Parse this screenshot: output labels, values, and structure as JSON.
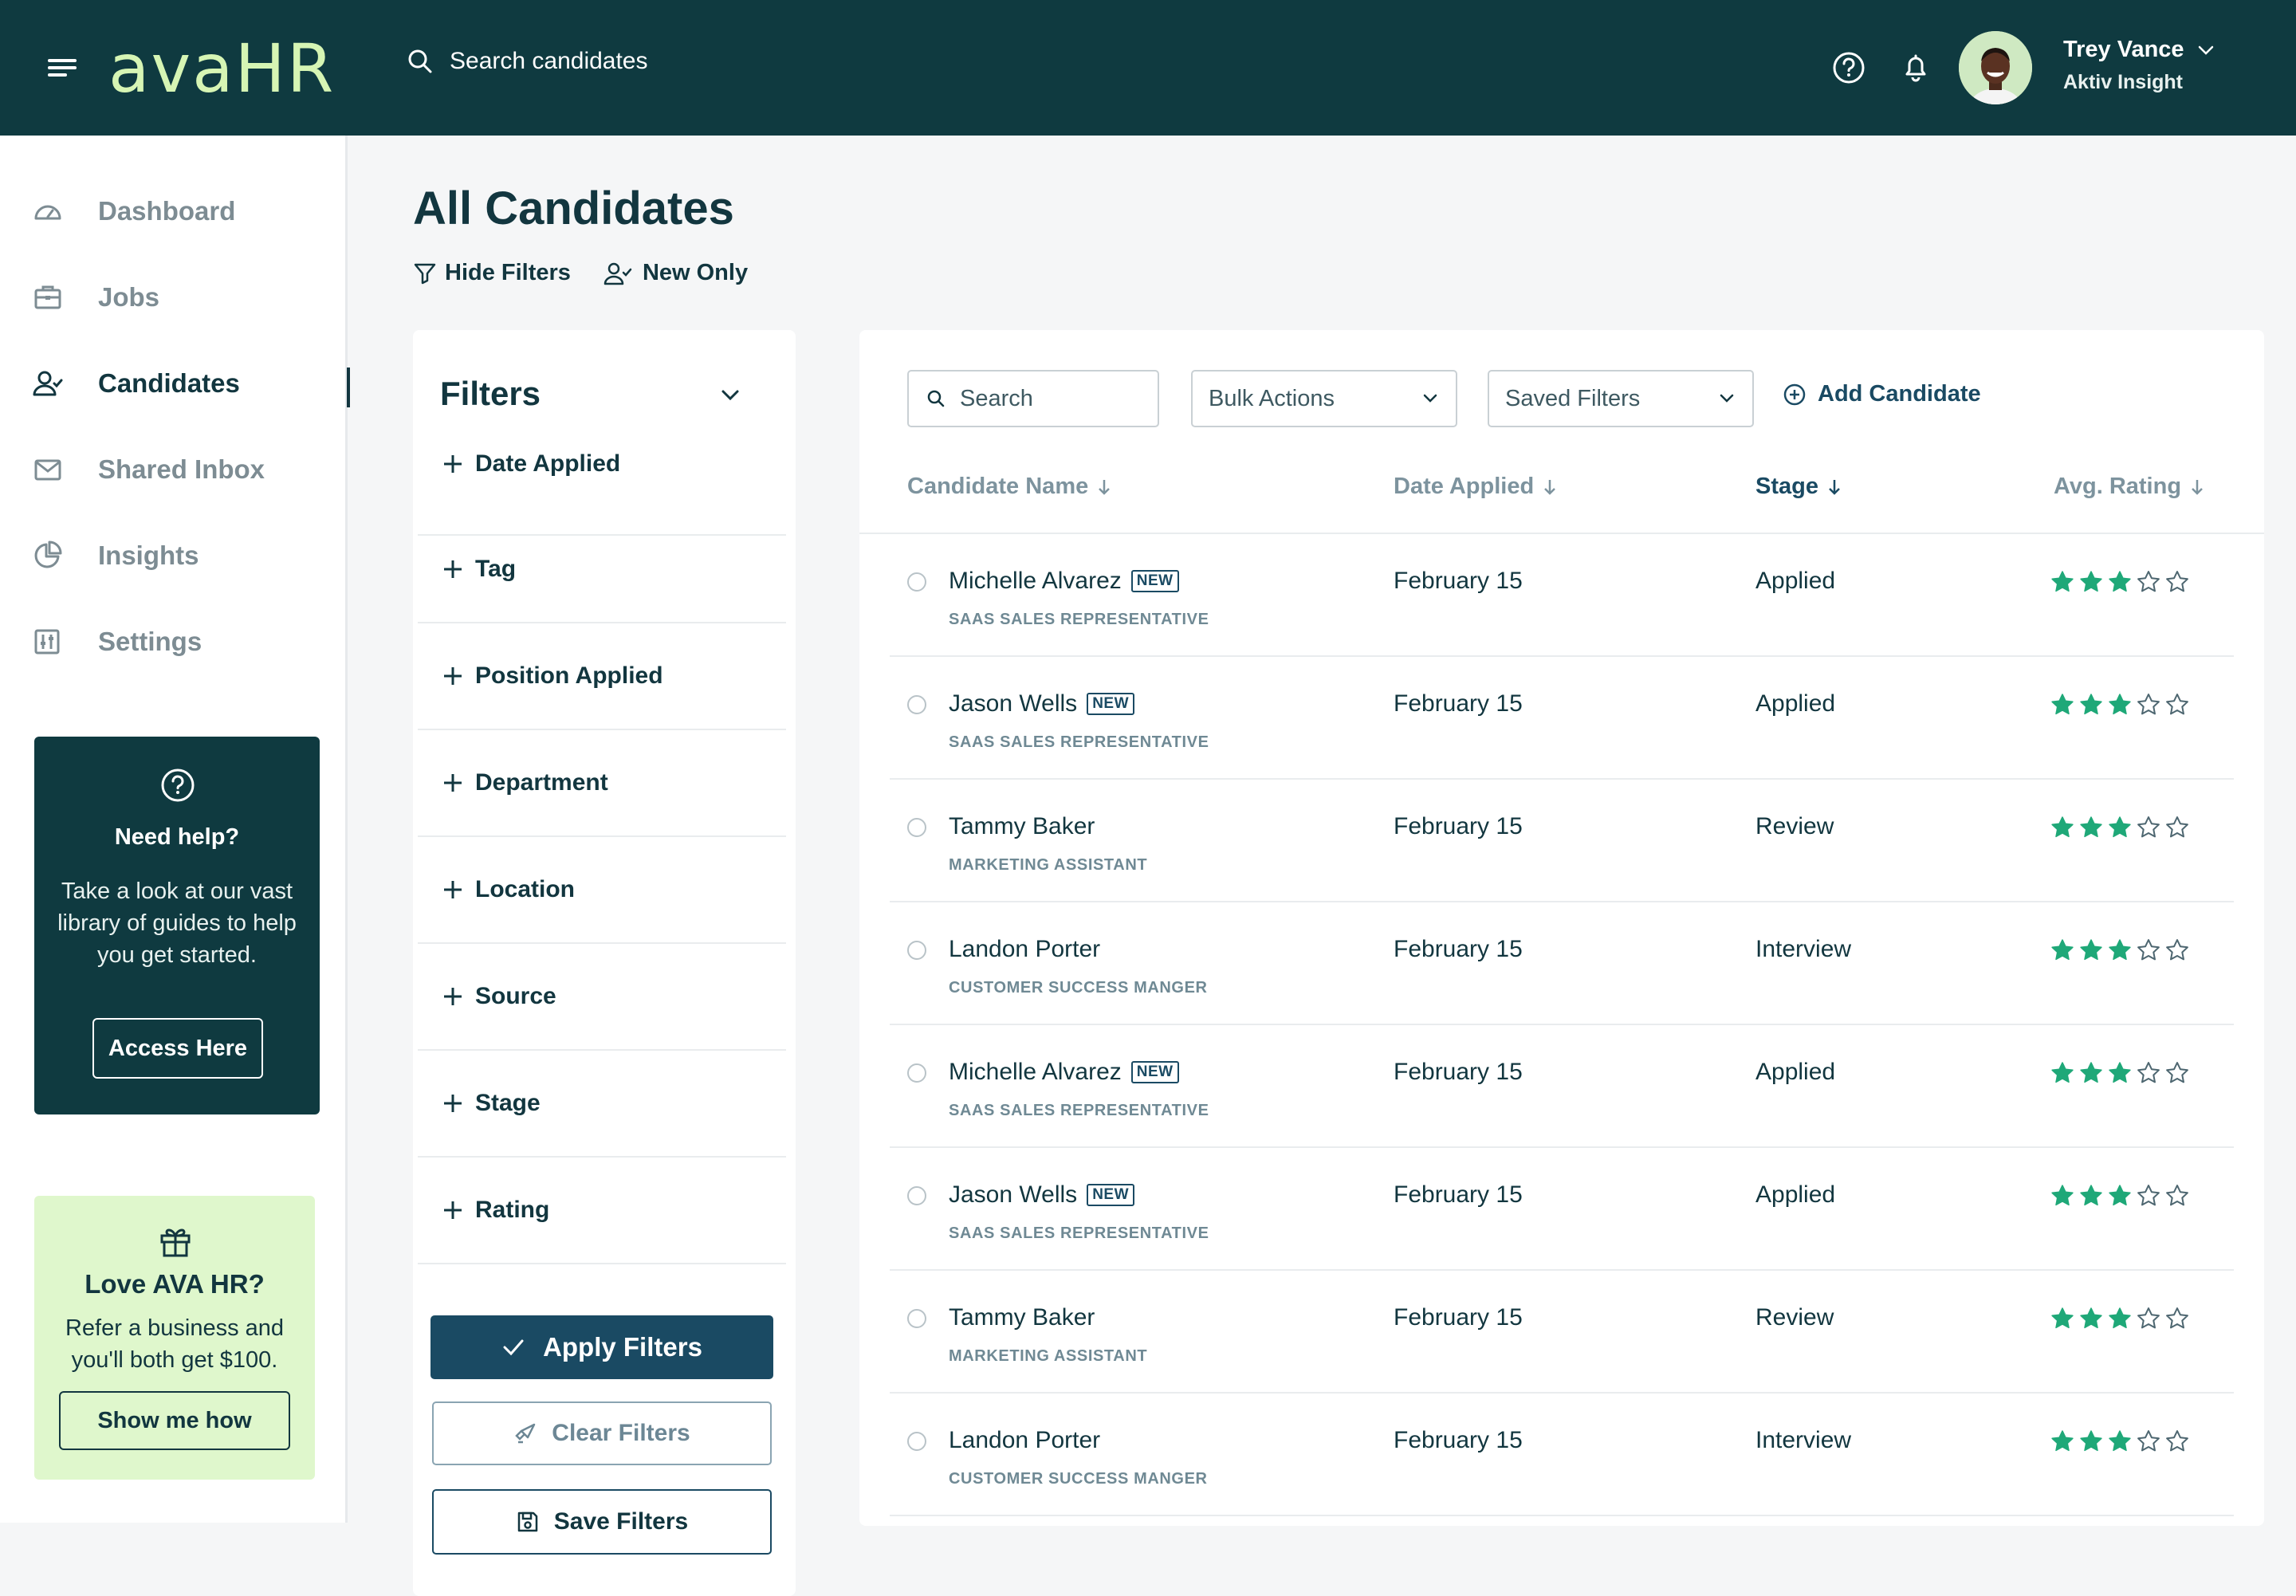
{
  "app": {
    "logo": "avaHR"
  },
  "topbar": {
    "search_placeholder": "Search candidates",
    "user": {
      "name": "Trey Vance",
      "company": "Aktiv Insight"
    },
    "icons": [
      "menu-icon",
      "search-icon",
      "help-icon",
      "bell-icon",
      "chevron-down-icon"
    ]
  },
  "sidebar": {
    "items": [
      {
        "label": "Dashboard",
        "icon": "dashboard-icon",
        "active": false
      },
      {
        "label": "Jobs",
        "icon": "briefcase-icon",
        "active": false
      },
      {
        "label": "Candidates",
        "icon": "user-check-icon",
        "active": true
      },
      {
        "label": "Shared Inbox",
        "icon": "mail-icon",
        "active": false
      },
      {
        "label": "Insights",
        "icon": "pie-chart-icon",
        "active": false
      },
      {
        "label": "Settings",
        "icon": "sliders-icon",
        "active": false
      }
    ],
    "help": {
      "title": "Need help?",
      "text": "Take a look at our vast library of guides to help you get started.",
      "button": "Access Here"
    },
    "refer": {
      "title": "Love AVA HR?",
      "text": "Refer a business and you'll both get $100.",
      "button": "Show me how"
    }
  },
  "page": {
    "title": "All Candidates",
    "hide_filters": "Hide Filters",
    "new_only": "New Only"
  },
  "filters": {
    "title": "Filters",
    "items": [
      "Date Applied",
      "Tag",
      "Position Applied",
      "Department",
      "Location",
      "Source",
      "Stage",
      "Rating"
    ],
    "apply": "Apply Filters",
    "clear": "Clear Filters",
    "save": "Save Filters"
  },
  "toolbar": {
    "search_placeholder": "Search",
    "bulk_actions": "Bulk Actions",
    "saved_filters": "Saved Filters",
    "add_candidate": "Add Candidate"
  },
  "table": {
    "columns": [
      "Candidate Name",
      "Date Applied",
      "Stage",
      "Avg. Rating"
    ],
    "new_badge": "NEW",
    "rows": [
      {
        "name": "Michelle Alvarez",
        "new": true,
        "position": "SAAS SALES REPRESENTATIVE",
        "date": "February 15",
        "stage": "Applied",
        "rating": 3,
        "max_rating": 5
      },
      {
        "name": "Jason Wells",
        "new": true,
        "position": "SAAS SALES REPRESENTATIVE",
        "date": "February 15",
        "stage": "Applied",
        "rating": 3,
        "max_rating": 5
      },
      {
        "name": "Tammy Baker",
        "new": false,
        "position": "MARKETING ASSISTANT",
        "date": "February 15",
        "stage": "Review",
        "rating": 3,
        "max_rating": 5
      },
      {
        "name": "Landon Porter",
        "new": false,
        "position": "CUSTOMER SUCCESS MANGER",
        "date": "February 15",
        "stage": "Interview",
        "rating": 3,
        "max_rating": 5
      },
      {
        "name": "Michelle Alvarez",
        "new": true,
        "position": "SAAS SALES REPRESENTATIVE",
        "date": "February 15",
        "stage": "Applied",
        "rating": 3,
        "max_rating": 5
      },
      {
        "name": "Jason Wells",
        "new": true,
        "position": "SAAS SALES REPRESENTATIVE",
        "date": "February 15",
        "stage": "Applied",
        "rating": 3,
        "max_rating": 5
      },
      {
        "name": "Tammy Baker",
        "new": false,
        "position": "MARKETING ASSISTANT",
        "date": "February 15",
        "stage": "Review",
        "rating": 3,
        "max_rating": 5
      },
      {
        "name": "Landon Porter",
        "new": false,
        "position": "CUSTOMER SUCCESS MANGER",
        "date": "February 15",
        "stage": "Interview",
        "rating": 3,
        "max_rating": 5
      }
    ]
  },
  "colors": {
    "topbar_bg": "#0f3a40",
    "logo": "#d6f5b4",
    "primary": "#1a4a63",
    "star": "#1fa878",
    "refer_bg": "#dff7cc"
  }
}
